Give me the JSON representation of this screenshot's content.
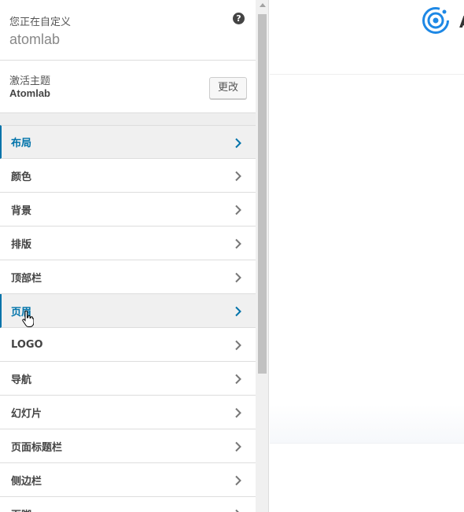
{
  "customize": {
    "label": "您正在自定义",
    "site_name": "atomlab",
    "help_icon": "question-circle-icon"
  },
  "theme": {
    "label": "激活主题",
    "name": "Atomlab",
    "change_button": "更改"
  },
  "panels": [
    {
      "label": "布局",
      "active": true
    },
    {
      "label": "颜色",
      "active": false
    },
    {
      "label": "背景",
      "active": false
    },
    {
      "label": "排版",
      "active": false
    },
    {
      "label": "顶部栏",
      "active": false
    },
    {
      "label": "页眉",
      "active": true
    },
    {
      "label": "LOGO",
      "active": false
    },
    {
      "label": "导航",
      "active": false
    },
    {
      "label": "幻灯片",
      "active": false
    },
    {
      "label": "页面标题栏",
      "active": false
    },
    {
      "label": "侧边栏",
      "active": false
    },
    {
      "label": "页脚",
      "active": false
    }
  ],
  "colors": {
    "accent": "#0073aa",
    "logo": "#1e88e5"
  },
  "preview": {
    "logo_icon": "atom-logo-icon",
    "logo_partial_text": "A"
  }
}
